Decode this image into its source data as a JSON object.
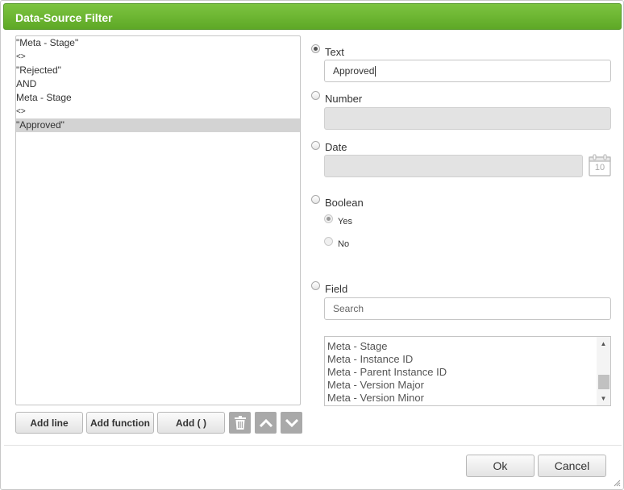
{
  "dialog": {
    "title": "Data-Source Filter"
  },
  "expression": {
    "lines": [
      {
        "text": "\"Meta - Stage\"",
        "small": false,
        "selected": false
      },
      {
        "text": "<>",
        "small": true,
        "selected": false
      },
      {
        "text": "\"Rejected\"",
        "small": false,
        "selected": false
      },
      {
        "text": "AND",
        "small": false,
        "selected": false
      },
      {
        "text": "Meta - Stage",
        "small": false,
        "selected": false
      },
      {
        "text": "<>",
        "small": true,
        "selected": false
      },
      {
        "text": "\"Approved\"",
        "small": false,
        "selected": true
      }
    ]
  },
  "toolbar": {
    "add_line": "Add line",
    "add_function": "Add function",
    "add_paren": "Add ( )",
    "delete_icon": "trash-icon",
    "move_up_icon": "chevron-up-icon",
    "move_down_icon": "chevron-down-icon"
  },
  "value_type": {
    "text": {
      "label": "Text",
      "value": "Approved",
      "checked": true
    },
    "number": {
      "label": "Number",
      "value": "",
      "checked": false
    },
    "date": {
      "label": "Date",
      "value": "",
      "checked": false,
      "calendar_day": "10"
    },
    "boolean": {
      "label": "Boolean",
      "checked": false,
      "yes_label": "Yes",
      "no_label": "No",
      "selected": "Yes"
    },
    "field": {
      "label": "Field",
      "checked": false,
      "search_placeholder": "Search",
      "items": [
        "Meta - Stage",
        "Meta - Instance ID",
        "Meta - Parent Instance ID",
        "Meta - Version Major",
        "Meta - Version Minor"
      ]
    }
  },
  "footer": {
    "ok_label": "Ok",
    "cancel_label": "Cancel"
  },
  "colors": {
    "title_bar": "#6bb530",
    "selection": "#d3d3d3",
    "icon_button": "#a9a9a9"
  }
}
